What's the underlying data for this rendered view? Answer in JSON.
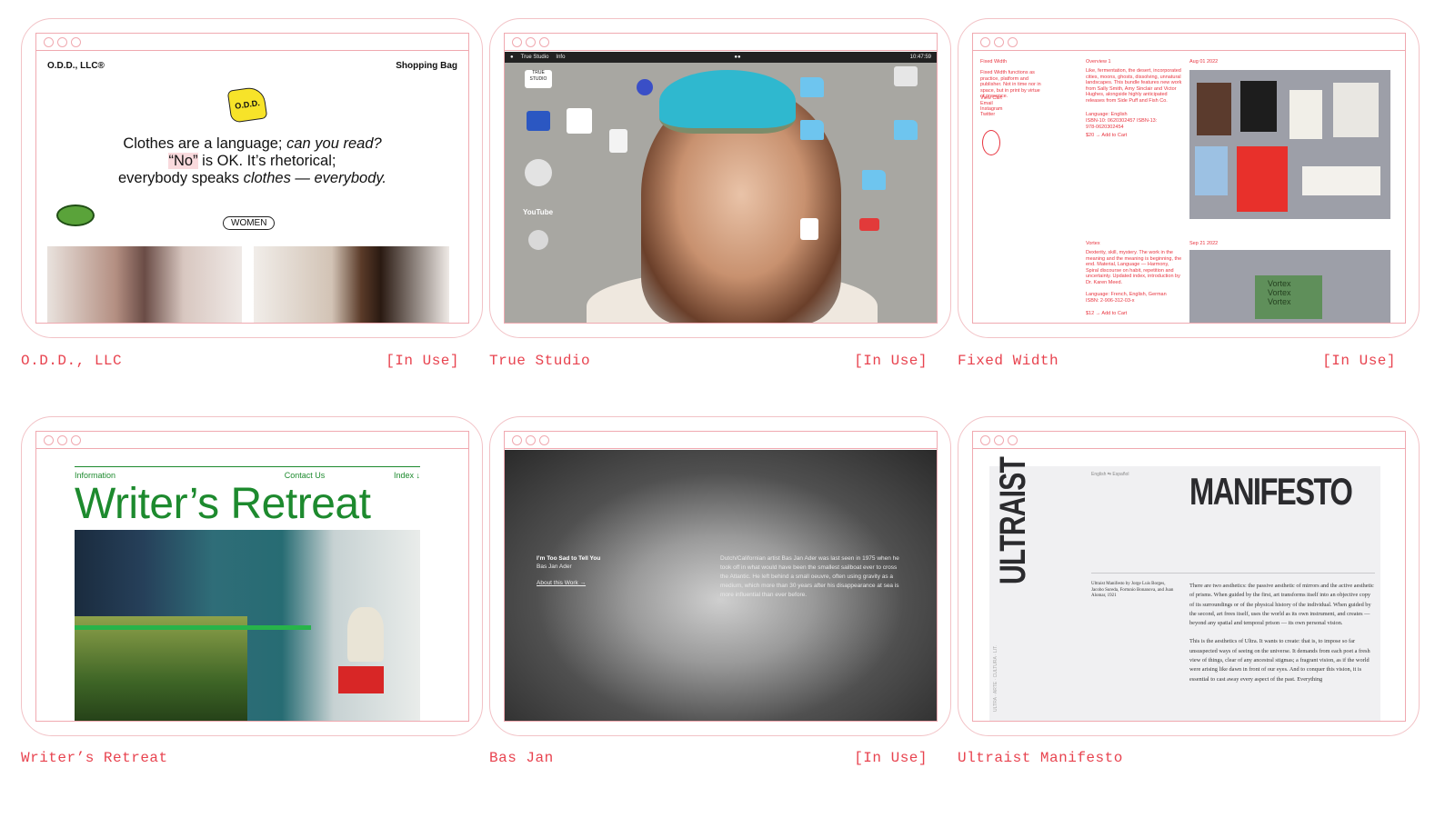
{
  "cards": [
    {
      "title": "O.D.D., LLC",
      "status": "[In Use]",
      "site": {
        "logo": "O.D.D., LLC®",
        "bag": "Shopping Bag",
        "flag_text": "O.D.D.",
        "headline_1a": "Clothes are a language; ",
        "headline_1b": "can you read?",
        "headline_2a": "“No”",
        "headline_2b": " is OK. It’s rhetorical;",
        "headline_3a": "everybody speaks ",
        "headline_3b": "clothes — everybody.",
        "women": "WOMEN"
      }
    },
    {
      "title": "True Studio",
      "status": "[In Use]",
      "site": {
        "app": "True Studio",
        "menu": "Info",
        "clock": "10:47:59",
        "logo_text": "TRUE STUDIO",
        "youtube": "YouTube"
      }
    },
    {
      "title": "Fixed Width",
      "status": "[In Use]",
      "site": {
        "brand": "Fixed Width",
        "intro": "Fixed Width functions as practice, platform and publisher. Not in time nor in space, but in print by virtue of presence.",
        "links": [
          "View Cart",
          "Email",
          "Instagram",
          "Twitter"
        ],
        "item1_title": "Overview 1",
        "item1_date": "Aug 01 2022",
        "item1_body": "Like, fermentation, the desert, incorporated cities, moons, ghosts, dissolving, unnatural landscapes. This bundle features new work from Sally Smith, Amy Sinclair and Victor Hughes, alongside highly anticipated releases from Side Puff and Fish Co.",
        "item1_lang": "Language: English",
        "item1_isbn": "ISBN-10: 0620302457 ISBN-13: 978-0620302454",
        "item1_cart": "$20 → Add to Cart",
        "item2_title": "Vortex",
        "item2_date": "Sep 21 2022",
        "item2_body": "Dexterity, skill, mystery. The work in the meaning and the meaning is beginning, the end. Material, Language — Harmony, Spiral discourse on habit, repetition and uncertainty. Updated index, introduction by Dr. Karen Meed.",
        "item2_lang": "Language: French, English, German",
        "item2_isbn": "ISBN: 2-906-312-03-x",
        "item2_cart": "$12 → Add to Cart",
        "vortex": "Vortex"
      }
    },
    {
      "title": "Writer’s Retreat",
      "status": "",
      "site": {
        "nav_info": "Information",
        "nav_contact": "Contact Us",
        "nav_index": "Index ↓",
        "heading": "Writer’s Retreat"
      }
    },
    {
      "title": "Bas Jan",
      "status": "[In Use]",
      "site": {
        "line1": "I’m Too Sad to Tell You",
        "line2": "Bas Jan Ader",
        "link": "About this Work →",
        "body": "Dutch/Californian artist Bas Jan Ader was last seen in 1975 when he took off in what would have been the smallest sailboat ever to cross the Atlantic. He left behind a small oeuvre, often using gravity as a medium, which more than 30 years after his disappearance at sea is more influential than ever before."
      }
    },
    {
      "title": "Ultraist Manifesto",
      "status": "",
      "site": {
        "vertical": "ULTRAIST",
        "heading": "MANIFESTO",
        "langs": "English  ⇆  Español",
        "credit": "Ultraist Manifesto by Jorge Luis Borges, Jacobo Sureda, Fortunio Bonanova, and Juan Alomar, 1921",
        "para1": "There are two aesthetics: the passive aesthetic of mirrors and the active aesthetic of prisms. When guided by the first, art transforms itself into an objective copy of its surroundings or of the physical history of the individual. When guided by the second, art frees itself, uses the world as its own instrument, and creates — beyond any spatial and temporal prison — its own personal vision.",
        "para2": "This is the aesthetics of Ultra. It wants to create: that is, to impose so far unsuspected ways of seeing on the universe. It demands from each poet a fresh view of things, clear of any ancestral stigmas; a fragrant vision, as if the world were arising like dawn in front of our eyes. And to conquer this vision, it is essential to cast away every aspect of the past. Everything",
        "side": "ULTRA · ARTE · CULTURA · LIT."
      }
    }
  ]
}
